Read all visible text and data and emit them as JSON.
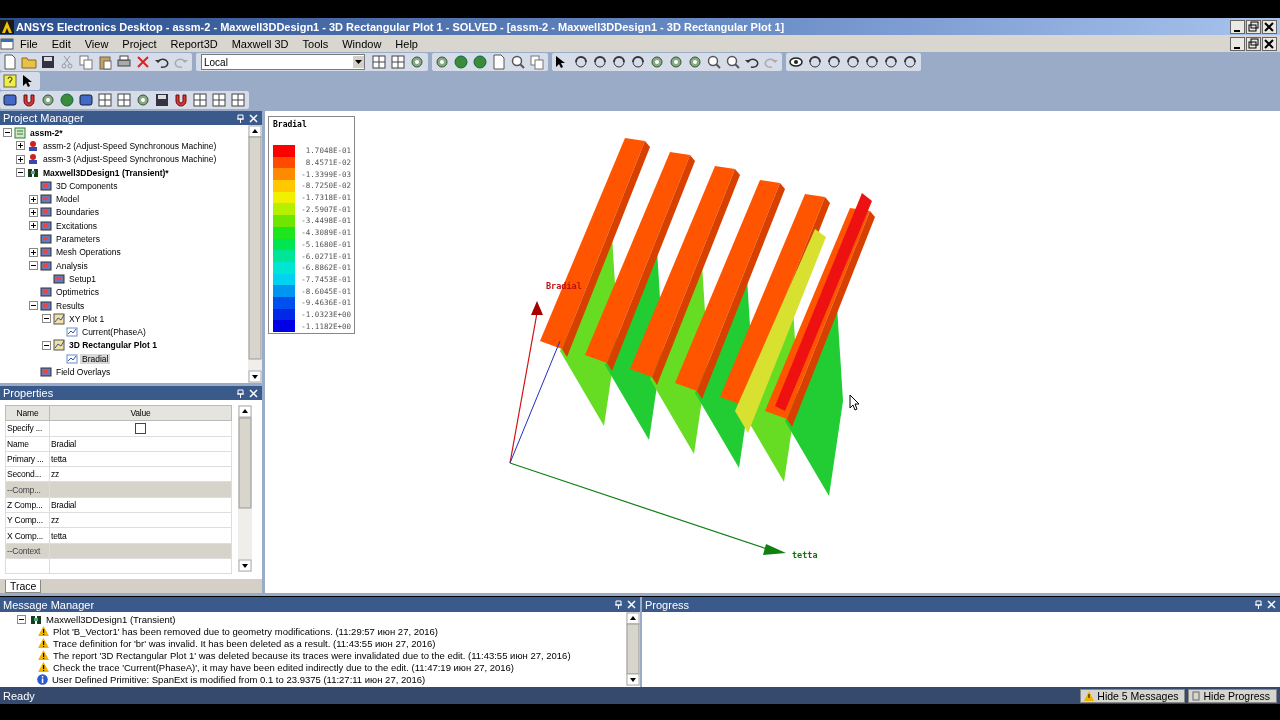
{
  "window": {
    "title": "ANSYS Electronics Desktop - assm-2 - Maxwell3DDesign1 - 3D Rectangular Plot 1 - SOLVED - [assm-2 - Maxwell3DDesign1 - 3D Rectangular Plot 1]"
  },
  "menu": [
    "File",
    "Edit",
    "View",
    "Project",
    "Report3D",
    "Maxwell 3D",
    "Tools",
    "Window",
    "Help"
  ],
  "toolbar": {
    "combo": "Local"
  },
  "project_manager": {
    "title": "Project Manager",
    "tree": [
      {
        "label": "assm-2*",
        "kind": "project",
        "expanded": true,
        "active": true,
        "selected": false,
        "children": [
          {
            "label": "assm-2 (Adjust-Speed Synchronous Machine)",
            "kind": "machine",
            "expanded": false,
            "active": false,
            "selected": false
          },
          {
            "label": "assm-3 (Adjust-Speed Synchronous Machine)",
            "kind": "machine",
            "expanded": false,
            "active": false,
            "selected": false
          },
          {
            "label": "Maxwell3DDesign1 (Transient)*",
            "kind": "design",
            "expanded": true,
            "active": true,
            "selected": false,
            "children": [
              {
                "label": "3D Components",
                "kind": "folder",
                "active": false,
                "selected": false
              },
              {
                "label": "Model",
                "kind": "folder",
                "expanded": false,
                "active": false,
                "selected": false
              },
              {
                "label": "Boundaries",
                "kind": "folder",
                "expanded": false,
                "active": false,
                "selected": false
              },
              {
                "label": "Excitations",
                "kind": "folder",
                "expanded": false,
                "active": false,
                "selected": false
              },
              {
                "label": "Parameters",
                "kind": "folder",
                "active": false,
                "selected": false
              },
              {
                "label": "Mesh Operations",
                "kind": "folder",
                "expanded": false,
                "active": false,
                "selected": false
              },
              {
                "label": "Analysis",
                "kind": "folder",
                "expanded": true,
                "active": false,
                "selected": false,
                "children": [
                  {
                    "label": "Setup1",
                    "kind": "folder",
                    "active": false,
                    "selected": false
                  }
                ]
              },
              {
                "label": "Optimetrics",
                "kind": "folder",
                "active": false,
                "selected": false
              },
              {
                "label": "Results",
                "kind": "folder",
                "expanded": true,
                "active": false,
                "selected": false,
                "children": [
                  {
                    "label": "XY Plot 1",
                    "kind": "plot",
                    "expanded": true,
                    "active": false,
                    "selected": false,
                    "children": [
                      {
                        "label": "Current(PhaseA)",
                        "kind": "trace",
                        "active": false,
                        "selected": false
                      }
                    ]
                  },
                  {
                    "label": "3D Rectangular Plot 1",
                    "kind": "plot",
                    "expanded": true,
                    "active": true,
                    "selected": false,
                    "children": [
                      {
                        "label": "Bradial",
                        "kind": "trace",
                        "active": false,
                        "selected": true
                      }
                    ]
                  }
                ]
              },
              {
                "label": "Field Overlays",
                "kind": "folder",
                "active": false,
                "selected": false
              }
            ]
          }
        ]
      }
    ]
  },
  "properties": {
    "title": "Properties",
    "columns": [
      "Name",
      "Value"
    ],
    "rows": [
      {
        "kind": "check",
        "name": "Specify ...",
        "checked": false
      },
      {
        "kind": "field",
        "name": "Name",
        "value": "Bradial"
      },
      {
        "kind": "field",
        "name": "Primary ...",
        "value": "tetta"
      },
      {
        "kind": "field",
        "name": "Second...",
        "value": "zz"
      },
      {
        "kind": "section",
        "name": "--Comp..."
      },
      {
        "kind": "field",
        "name": "Z Comp...",
        "value": "Bradial"
      },
      {
        "kind": "field",
        "name": "Y Comp...",
        "value": "zz"
      },
      {
        "kind": "field",
        "name": "X Comp...",
        "value": "tetta"
      },
      {
        "kind": "section",
        "name": "--Context"
      },
      {
        "kind": "empty"
      }
    ],
    "tab": "Trace"
  },
  "plot": {
    "legend": {
      "title": "Bradial",
      "entries": [
        {
          "value": "1.7048E-01",
          "color": "#ff0000"
        },
        {
          "value": "8.4571E-02",
          "color": "#ff4a00"
        },
        {
          "value": "-1.3399E-03",
          "color": "#ff8a00"
        },
        {
          "value": "-8.7250E-02",
          "color": "#ffc800"
        },
        {
          "value": "-1.7318E-01",
          "color": "#f0f000"
        },
        {
          "value": "-2.5907E-01",
          "color": "#b4f000"
        },
        {
          "value": "-3.4498E-01",
          "color": "#6ee600"
        },
        {
          "value": "-4.3089E-01",
          "color": "#1ee61e"
        },
        {
          "value": "-5.1680E-01",
          "color": "#00e650"
        },
        {
          "value": "-6.0271E-01",
          "color": "#00e696"
        },
        {
          "value": "-6.8862E-01",
          "color": "#00e6d2"
        },
        {
          "value": "-7.7453E-01",
          "color": "#00d2f0"
        },
        {
          "value": "-8.6045E-01",
          "color": "#0096f0"
        },
        {
          "value": "-9.4636E-01",
          "color": "#0050f0"
        },
        {
          "value": "-1.0323E+00",
          "color": "#0028e6"
        },
        {
          "value": "-1.1182E+00",
          "color": "#0000e6"
        }
      ]
    },
    "z_axis_label": "Bradial",
    "x_axis_label": "tetta"
  },
  "message_manager": {
    "title": "Message Manager",
    "group": "Maxwell3DDesign1 (Transient)",
    "messages": [
      {
        "kind": "warning",
        "text": "Plot 'B_Vector1' has been removed due to geometry modifications. (11:29:57  июн 27, 2016)"
      },
      {
        "kind": "warning",
        "text": "Trace definition for 'br' was invalid. It has been deleted as a result. (11:43:55  июн 27, 2016)"
      },
      {
        "kind": "warning",
        "text": "The report '3D Rectangular Plot 1' was deleted because its traces were invalidated due to the edit. (11:43:55  июн 27, 2016)"
      },
      {
        "kind": "warning",
        "text": "Check the trace 'Current(PhaseA)', it may have been edited indirectly due to the edit. (11:47:19  июн 27, 2016)"
      }
    ],
    "info": {
      "kind": "info",
      "text": "User Defined Primitive: SpanExt is modified from 0.1 to 23.9375 (11:27:11  июн 27, 2016)"
    }
  },
  "progress": {
    "title": "Progress"
  },
  "status_bar": {
    "text": "Ready",
    "buttons": [
      {
        "label": "Hide 5 Messages",
        "kind": "warning"
      },
      {
        "label": "Hide Progress",
        "kind": "plain"
      }
    ]
  }
}
